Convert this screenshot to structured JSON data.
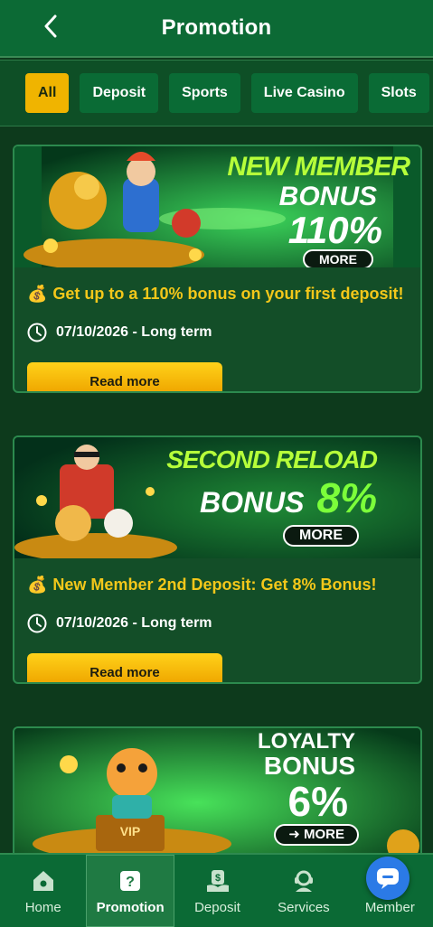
{
  "header": {
    "title": "Promotion"
  },
  "tabs": [
    {
      "label": "All",
      "active": true
    },
    {
      "label": "Deposit",
      "active": false
    },
    {
      "label": "Sports",
      "active": false
    },
    {
      "label": "Live Casino",
      "active": false
    },
    {
      "label": "Slots",
      "active": false
    }
  ],
  "promotions": [
    {
      "banner": {
        "line1": "NEW MEMBER",
        "line2": "BONUS",
        "line3": "110%",
        "cta": "MORE"
      },
      "title": "Get up to a 110% bonus on your first deposit!",
      "date": "07/10/2026 - Long term",
      "button": "Read more"
    },
    {
      "banner": {
        "line1": "SECOND RELOAD",
        "line2": "BONUS",
        "line3": "8%",
        "cta": "MORE"
      },
      "title": "New Member 2nd Deposit: Get 8% Bonus!",
      "date": "07/10/2026 - Long term",
      "button": "Read more"
    },
    {
      "banner": {
        "line1": "LOYALTY",
        "line2": "BONUS",
        "line3": "6%",
        "cta": "➜ MORE",
        "badge": "VIP"
      }
    }
  ],
  "bottom_nav": [
    {
      "label": "Home",
      "icon": "home-icon"
    },
    {
      "label": "Promotion",
      "icon": "gift-icon",
      "active": true
    },
    {
      "label": "Deposit",
      "icon": "money-hand-icon"
    },
    {
      "label": "Services",
      "icon": "headset-icon"
    },
    {
      "label": "Member",
      "icon": "user-icon"
    }
  ],
  "colors": {
    "header": "#0c6a35",
    "accent": "#f0b400",
    "title_text": "#f3c71a",
    "chat": "#2b7ae6"
  }
}
